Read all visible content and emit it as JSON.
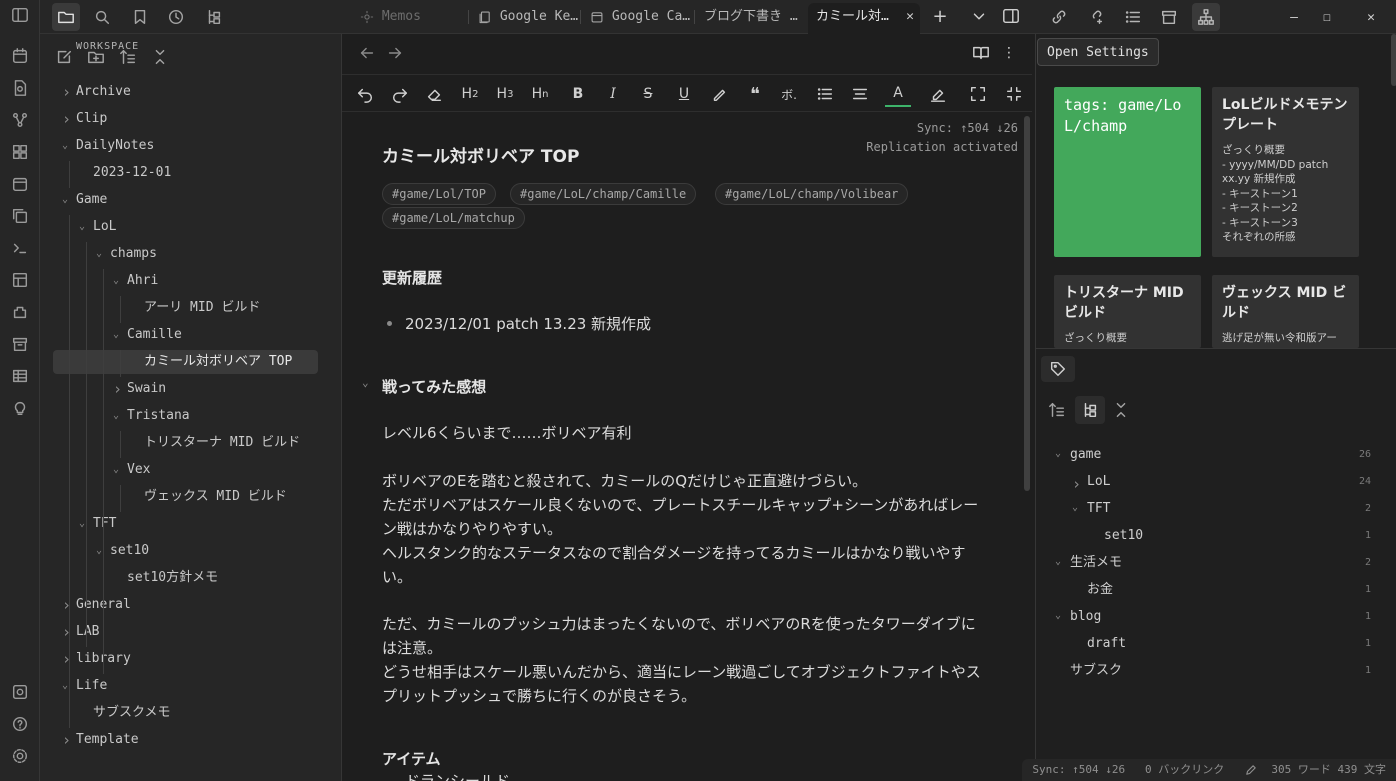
{
  "left_tree": {
    "section": "WORKSPACE",
    "items": [
      {
        "label": "Archive",
        "level": 0,
        "chev": "right"
      },
      {
        "label": "Clip",
        "level": 0,
        "chev": "right"
      },
      {
        "label": "DailyNotes",
        "level": 0,
        "chev": "down"
      },
      {
        "label": "2023-12-01",
        "level": 1,
        "chev": ""
      },
      {
        "label": "Game",
        "level": 0,
        "chev": "down"
      },
      {
        "label": "LoL",
        "level": 1,
        "chev": "down"
      },
      {
        "label": "champs",
        "level": 2,
        "chev": "down"
      },
      {
        "label": "Ahri",
        "level": 3,
        "chev": "down"
      },
      {
        "label": "アーリ MID ビルド",
        "level": 4,
        "chev": ""
      },
      {
        "label": "Camille",
        "level": 3,
        "chev": "down"
      },
      {
        "label": "カミール対ボリベア TOP",
        "level": 4,
        "chev": "",
        "selected": true
      },
      {
        "label": "Swain",
        "level": 3,
        "chev": "right"
      },
      {
        "label": "Tristana",
        "level": 3,
        "chev": "down"
      },
      {
        "label": "トリスターナ MID ビルド",
        "level": 4,
        "chev": ""
      },
      {
        "label": "Vex",
        "level": 3,
        "chev": "down"
      },
      {
        "label": "ヴェックス MID ビルド",
        "level": 4,
        "chev": ""
      },
      {
        "label": "TFT",
        "level": 1,
        "chev": "down"
      },
      {
        "label": "set10",
        "level": 2,
        "chev": "down"
      },
      {
        "label": "set10方針メモ",
        "level": 3,
        "chev": ""
      },
      {
        "label": "General",
        "level": 0,
        "chev": "right"
      },
      {
        "label": "LAB",
        "level": 0,
        "chev": "right"
      },
      {
        "label": "library",
        "level": 0,
        "chev": "right"
      },
      {
        "label": "Life",
        "level": 0,
        "chev": "down"
      },
      {
        "label": "サブスクメモ",
        "level": 1,
        "chev": ""
      },
      {
        "label": "Template",
        "level": 0,
        "chev": "right"
      }
    ]
  },
  "tabs": [
    {
      "label": "Memos",
      "dim": true
    },
    {
      "label": "Google Ke…"
    },
    {
      "label": "Google Ca…"
    },
    {
      "label": "ブログ下書き …"
    },
    {
      "label": "カミール対…",
      "active": true
    }
  ],
  "note": {
    "title": "カミール対ボリベア TOP",
    "sync_line1": "Sync: ↑504 ↓26",
    "sync_line2": "Replication activated",
    "tags": [
      "#game/Lol/TOP",
      "#game/LoL/champ/Camille",
      "#game/LoL/champ/Volibear",
      "#game/LoL/matchup"
    ],
    "h_history": "更新履歴",
    "history_item": "2023/12/01 patch 13.23 新規作成",
    "h_impression": "戦ってみた感想",
    "para1": "レベル6くらいまで……ボリベア有利",
    "para2": "ボリベアのEを踏むと殺されて、カミールのQだけじゃ正直避けづらい。\nただボリベアはスケール良くないので、プレートスチールキャップ+シーンがあればレーン戦はかなりやりやすい。\nヘルスタンク的なステータスなので割合ダメージを持ってるカミールはかなり戦いやすい。",
    "para3": "ただ、カミールのプッシュ力はまったくないので、ボリベアのRを使ったタワーダイブには注意。\nどうせ相手はスケール悪いんだから、適当にレーン戦過ごしてオブジェクトファイトやスプリットプッシュで勝ちに行くのが良さそう。",
    "h_item": "アイテム",
    "item_partial": "ドランシールド"
  },
  "tooltip": "Open Settings",
  "cards": [
    {
      "title": "tags: game/LoL/champ",
      "body": "",
      "green": true
    },
    {
      "title": "LoLビルドメモテンプレート",
      "body": "ざっくり概要\n- yyyy/MM/DD patch xx.yy 新規作成\n- キーストーン1\n- キーストーン2\n- キーストーン3\nそれぞれの所感"
    },
    {
      "title": "トリスターナ MID ビルド",
      "body": "ざっくり概要"
    },
    {
      "title": "ヴェックス MID ビルド",
      "body": "逃げ足が無い令和版アー"
    }
  ],
  "tag_tree": [
    {
      "label": "game",
      "count": "26",
      "level": 0,
      "chev": "down"
    },
    {
      "label": "LoL",
      "count": "24",
      "level": 1,
      "chev": "right"
    },
    {
      "label": "TFT",
      "count": "2",
      "level": 1,
      "chev": "down"
    },
    {
      "label": "set10",
      "count": "1",
      "level": 2,
      "chev": ""
    },
    {
      "label": "生活メモ",
      "count": "2",
      "level": 0,
      "chev": "down"
    },
    {
      "label": "お金",
      "count": "1",
      "level": 1,
      "chev": ""
    },
    {
      "label": "blog",
      "count": "1",
      "level": 0,
      "chev": "down"
    },
    {
      "label": "draft",
      "count": "1",
      "level": 1,
      "chev": ""
    },
    {
      "label": "サブスク",
      "count": "1",
      "level": 0,
      "chev": ""
    }
  ],
  "statusbar": {
    "sync": "Sync:  ↑504 ↓26",
    "backlinks": "0 バックリンク",
    "words": "305 ワード 439 文字"
  }
}
